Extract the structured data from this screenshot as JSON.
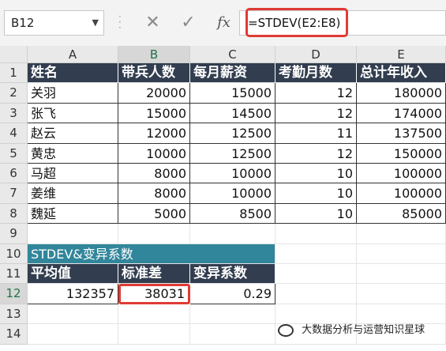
{
  "namebox": {
    "value": "B12"
  },
  "formula_bar": {
    "cancel_icon": "✕",
    "enter_icon": "✓",
    "fx_label": "fx",
    "value": "=STDEV(E2:E8)"
  },
  "columns": [
    "A",
    "B",
    "C",
    "D",
    "E"
  ],
  "rows": [
    "1",
    "2",
    "3",
    "4",
    "5",
    "6",
    "7",
    "8",
    "9",
    "10",
    "11",
    "12",
    "13",
    "14"
  ],
  "table": {
    "headers": [
      "姓名",
      "带兵人数",
      "每月薪资",
      "考勤月数",
      "总计年收入"
    ],
    "rows": [
      [
        "关羽",
        "20000",
        "15000",
        "12",
        "180000"
      ],
      [
        "张飞",
        "15000",
        "14500",
        "12",
        "174000"
      ],
      [
        "赵云",
        "12000",
        "12500",
        "11",
        "137500"
      ],
      [
        "黄忠",
        "10000",
        "12500",
        "12",
        "150000"
      ],
      [
        "马超",
        "8000",
        "10000",
        "10",
        "100000"
      ],
      [
        "姜维",
        "8000",
        "10000",
        "10",
        "100000"
      ],
      [
        "魏延",
        "5000",
        "8500",
        "10",
        "85000"
      ]
    ]
  },
  "summary": {
    "title": "STDEV&变异系数",
    "headers": [
      "平均值",
      "标准差",
      "变异系数"
    ],
    "values": [
      "132357",
      "38031",
      "0.29"
    ]
  },
  "watermark": "大数据分析与运营知识星球",
  "colors": {
    "header_bg": "#323e4f",
    "teal": "#31869b",
    "highlight": "#e03b34"
  }
}
